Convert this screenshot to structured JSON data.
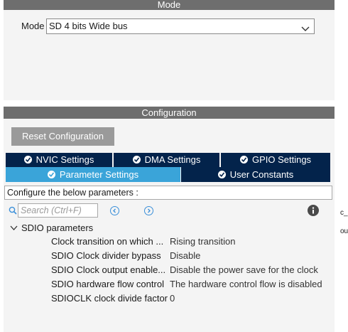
{
  "mode_panel": {
    "header": "Mode",
    "mode_label": "Mode",
    "mode_value": "SD 4 bits Wide bus"
  },
  "config_panel": {
    "header": "Configuration",
    "reset_button": "Reset Configuration",
    "tabs": [
      {
        "label": "NVIC Settings"
      },
      {
        "label": "DMA Settings"
      },
      {
        "label": "GPIO Settings"
      },
      {
        "label": "Parameter Settings"
      },
      {
        "label": "User Constants"
      }
    ],
    "description": "Configure the below parameters :",
    "search_placeholder": "Search (Ctrl+F)",
    "group": {
      "title": "SDIO parameters",
      "params": [
        {
          "name": "Clock transition on which ...",
          "value": "Rising transition"
        },
        {
          "name": "SDIO Clock divider bypass",
          "value": "Disable"
        },
        {
          "name": "SDIO Clock output enable...",
          "value": "Disable the power save for the clock"
        },
        {
          "name": "SDIO hardware flow control",
          "value": "The hardware control flow is disabled"
        },
        {
          "name": "SDIOCLK clock divide factor",
          "value": "0"
        }
      ]
    },
    "right_edge_text": [
      "c_",
      "ou"
    ]
  },
  "colors": {
    "tab_dark": "#03234b",
    "tab_active": "#3aa4d9",
    "header_bg": "#6e6e6e",
    "reset_bg": "#9a9a9a"
  }
}
